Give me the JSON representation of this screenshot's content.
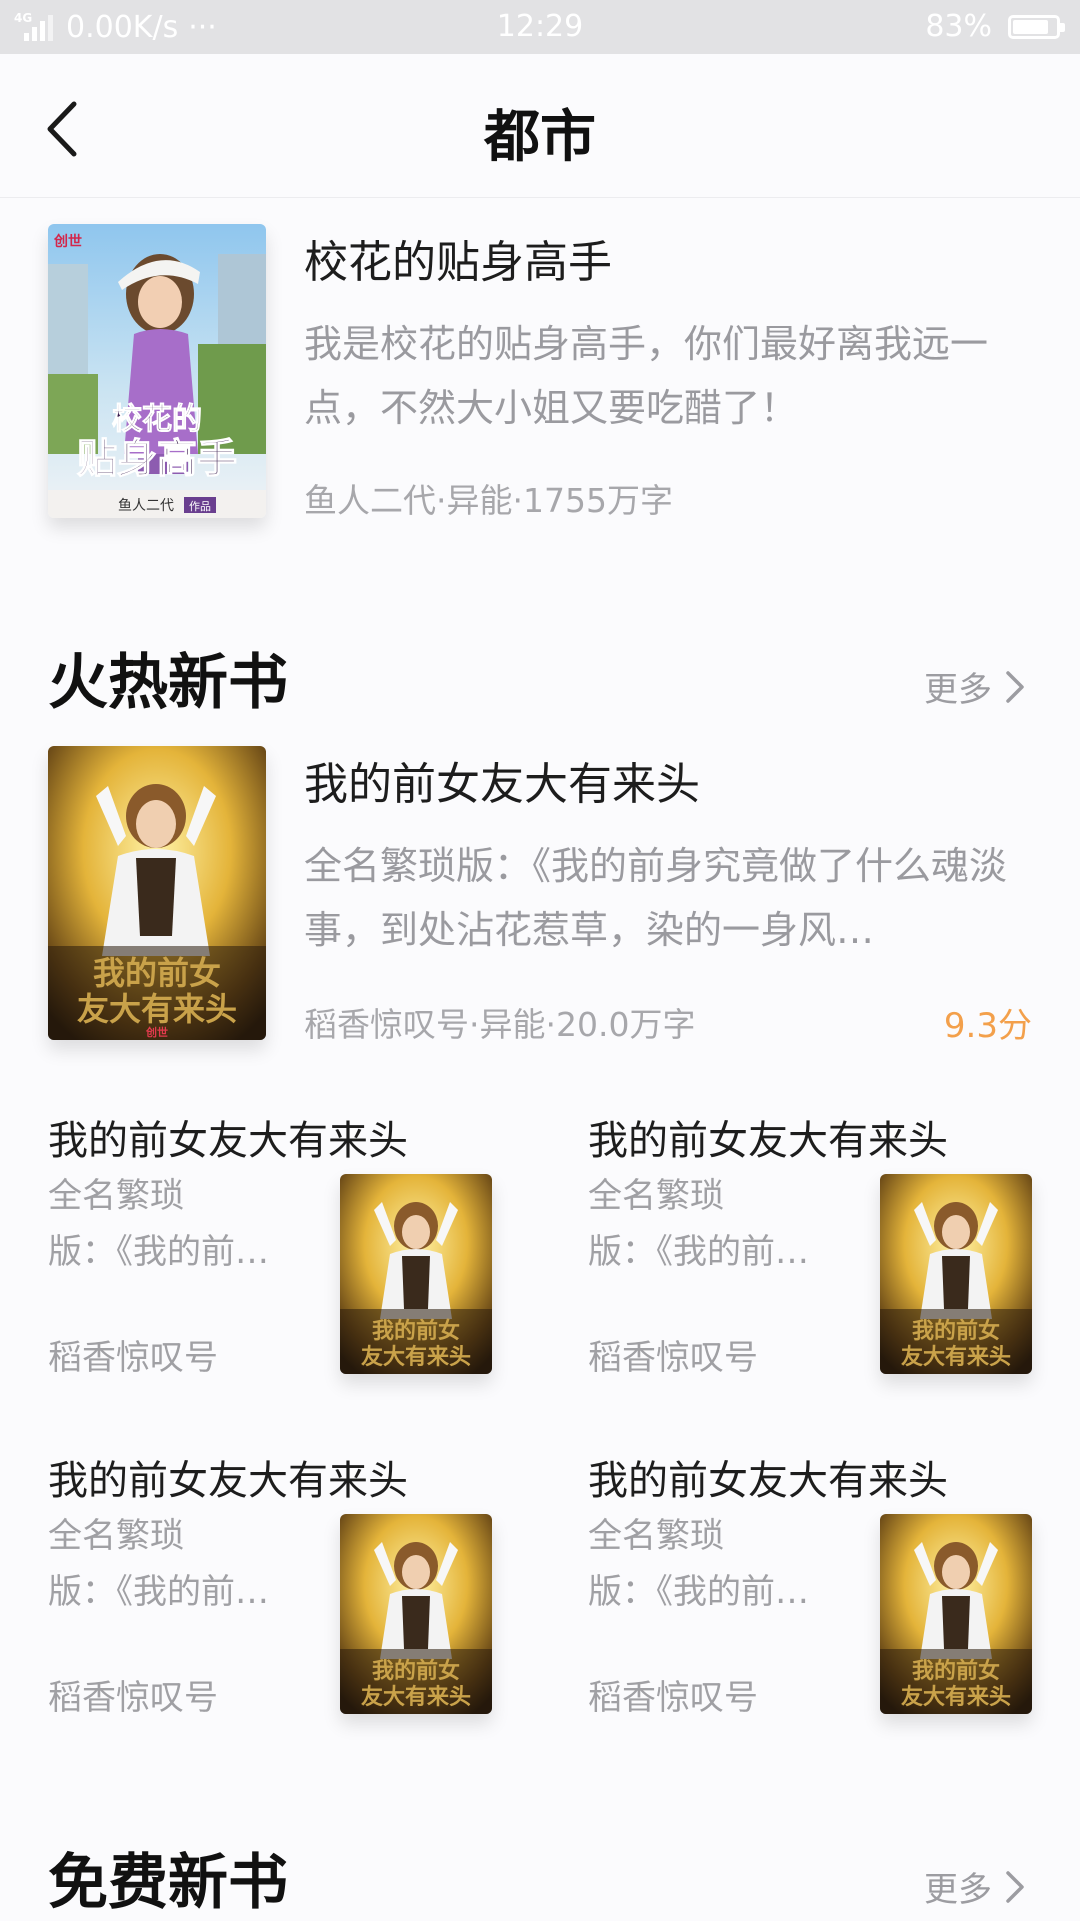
{
  "status_bar": {
    "network": "4G",
    "speed": "0.00K/s",
    "dots": "···",
    "time": "12:29",
    "battery_text": "83%",
    "battery_level": 0.83
  },
  "header": {
    "title": "都市",
    "back_icon": "chevron-left-icon"
  },
  "featured": {
    "title": "校花的贴身高手",
    "description": "我是校花的贴身高手，你们最好离我远一点，不然大小姐又要吃醋了！",
    "meta": "鱼人二代·异能·1755万字",
    "cover_title_line1": "校花的",
    "cover_title_line2": "贴身高手",
    "cover_author": "鱼人二代",
    "cover_badge": "作品",
    "cover_publisher": "创世"
  },
  "hot_section": {
    "title": "火热新书",
    "more_label": "更多",
    "main": {
      "title": "我的前女友大有来头",
      "description": "全名繁琐版：《我的前身究竟做了什么魂淡事，到处沾花惹草，染的一身风…",
      "meta": "稻香惊叹号·异能·20.0万字",
      "score": "9.3分",
      "cover_line1": "我的前女",
      "cover_line2": "友大有来头",
      "cover_publisher": "创世"
    },
    "grid": [
      {
        "title": "我的前女友大有来头",
        "desc_line1": "全名繁琐",
        "desc_line2": "版：《我的前…",
        "author": "稻香惊叹号"
      },
      {
        "title": "我的前女友大有来头",
        "desc_line1": "全名繁琐",
        "desc_line2": "版：《我的前…",
        "author": "稻香惊叹号"
      },
      {
        "title": "我的前女友大有来头",
        "desc_line1": "全名繁琐",
        "desc_line2": "版：《我的前…",
        "author": "稻香惊叹号"
      },
      {
        "title": "我的前女友大有来头",
        "desc_line1": "全名繁琐",
        "desc_line2": "版：《我的前…",
        "author": "稻香惊叹号"
      }
    ]
  },
  "free_section": {
    "title": "免费新书",
    "more_label": "更多"
  },
  "colors": {
    "score": "#f3a04b",
    "secondary_text": "#9a9a9f",
    "status_bar": "#e2e2e4"
  }
}
